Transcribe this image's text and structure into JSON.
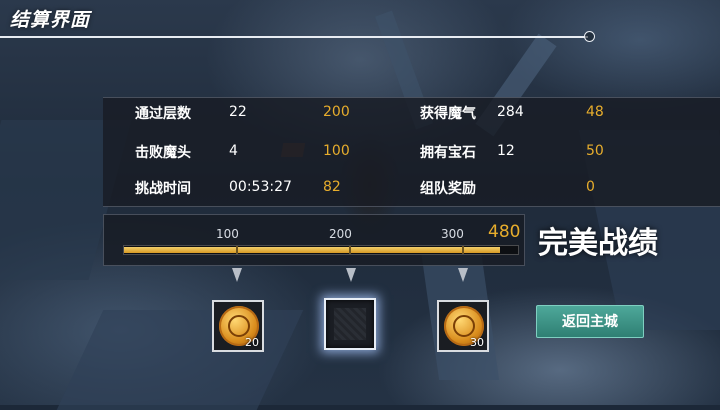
{
  "header": {
    "title": "结算界面"
  },
  "stats": [
    {
      "label": "通过层数",
      "value": "22",
      "points": "200"
    },
    {
      "label": "击败魔头",
      "value": "4",
      "points": "100"
    },
    {
      "label": "挑战时间",
      "value": "00:53:27",
      "points": "82"
    },
    {
      "label": "获得魔气",
      "value": "284",
      "points": "48"
    },
    {
      "label": "拥有宝石",
      "value": "12",
      "points": "50"
    },
    {
      "label": "组队奖励",
      "value": "",
      "points": "0"
    }
  ],
  "progress": {
    "ticks": [
      "100",
      "200",
      "300"
    ],
    "total": "480",
    "fill_fraction": 0.96,
    "grade": "完美战绩"
  },
  "rewards": [
    {
      "type": "coin",
      "count": "20",
      "icon": "gold-coin-icon",
      "state": "unlocked"
    },
    {
      "type": "locked",
      "count": "",
      "icon": "locked-reward-icon",
      "state": "locked"
    },
    {
      "type": "coin",
      "count": "30",
      "icon": "gold-coin-icon",
      "state": "unlocked"
    }
  ],
  "buttons": {
    "return_label": "返回主城"
  },
  "colors": {
    "accent_gold": "#e7ad2c",
    "button_teal": "#3e968a"
  }
}
